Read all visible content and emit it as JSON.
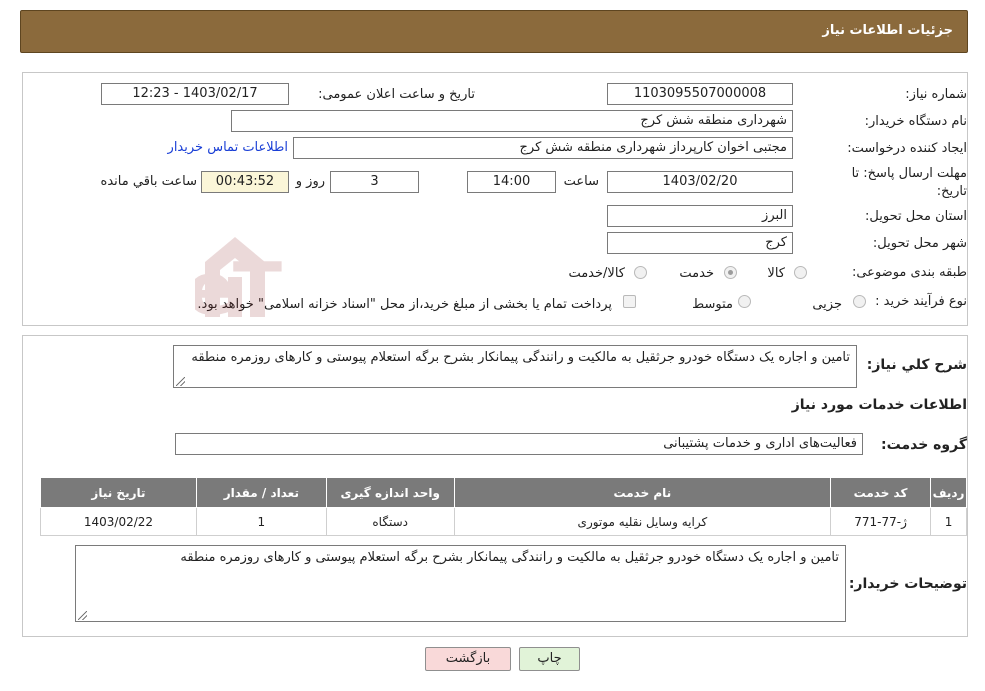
{
  "header": {
    "title": "جزئیات اطلاعات نیاز"
  },
  "form": {
    "need_number_label": "شماره نیاز:",
    "need_number": "1103095507000008",
    "announce_label": "تاریخ و ساعت اعلان عمومی:",
    "announce_value": "1403/02/17 - 12:23",
    "buyer_org_label": "نام دستگاه خریدار:",
    "buyer_org": "شهرداری منطقه شش کرج",
    "creator_label": "ایجاد کننده درخواست:",
    "creator": "مجتبی اخوان کارپرداز شهرداری منطقه شش کرج",
    "contact_link": "اطلاعات تماس خریدار",
    "deadline_label": "مهلت ارسال پاسخ: تا تاریخ:",
    "deadline_date": "1403/02/20",
    "time_label": "ساعت",
    "deadline_time": "14:00",
    "days_value": "3",
    "days_label": "روز و",
    "remaining_time": "00:43:52",
    "remaining_label": "ساعت باقي مانده",
    "province_label": "استان محل تحویل:",
    "province": "البرز",
    "city_label": "شهر محل تحویل:",
    "city": "کرج",
    "category_label": "طبقه بندی موضوعی:",
    "category_options": [
      "کالا",
      "خدمت",
      "کالا/خدمت"
    ],
    "category_selected": "خدمت",
    "process_label": "نوع فرآیند خرید :",
    "process_options": [
      "جزیی",
      "متوسط"
    ],
    "payment_note": "پرداخت تمام یا بخشی از مبلغ خرید،از محل \"اسناد خزانه اسلامی\" خواهد بود."
  },
  "summary": {
    "label": "شرح کلي نياز:",
    "text": "تامین و اجاره یک دستگاه خودرو جرثقیل  به مالکیت و رانندگی پیمانکار بشرح برگه استعلام پیوستی و کارهای روزمره منطقه"
  },
  "services": {
    "section_title": "اطلاعات خدمات مورد نیاز",
    "group_label": "گروه خدمت:",
    "group_value": "فعالیت‌های اداری و خدمات پشتیبانی",
    "columns": [
      "ردیف",
      "کد خدمت",
      "نام خدمت",
      "واحد اندازه گیری",
      "تعداد / مقدار",
      "تاریخ نیاز"
    ],
    "rows": [
      [
        "1",
        "ژ-77-771",
        "کرایه وسایل نقلیه موتوری",
        "دستگاه",
        "1",
        "1403/02/22"
      ]
    ]
  },
  "buyer_notes": {
    "label": "توضیحات خریدار:",
    "text": "تامین و اجاره یک دستگاه خودرو جرثقیل  به مالکیت و رانندگی پیمانکار بشرح برگه استعلام پیوستی و کارهای روزمره منطقه"
  },
  "buttons": {
    "print": "چاپ",
    "back": "بازگشت"
  },
  "watermark": {
    "text": "AriaTender.neT"
  },
  "colors": {
    "header": "#8b6a3c",
    "table_header": "#7a7a7a",
    "link": "#1a3fd6",
    "back_button": "#f9d9d9",
    "print_button": "#e1f3d8"
  }
}
